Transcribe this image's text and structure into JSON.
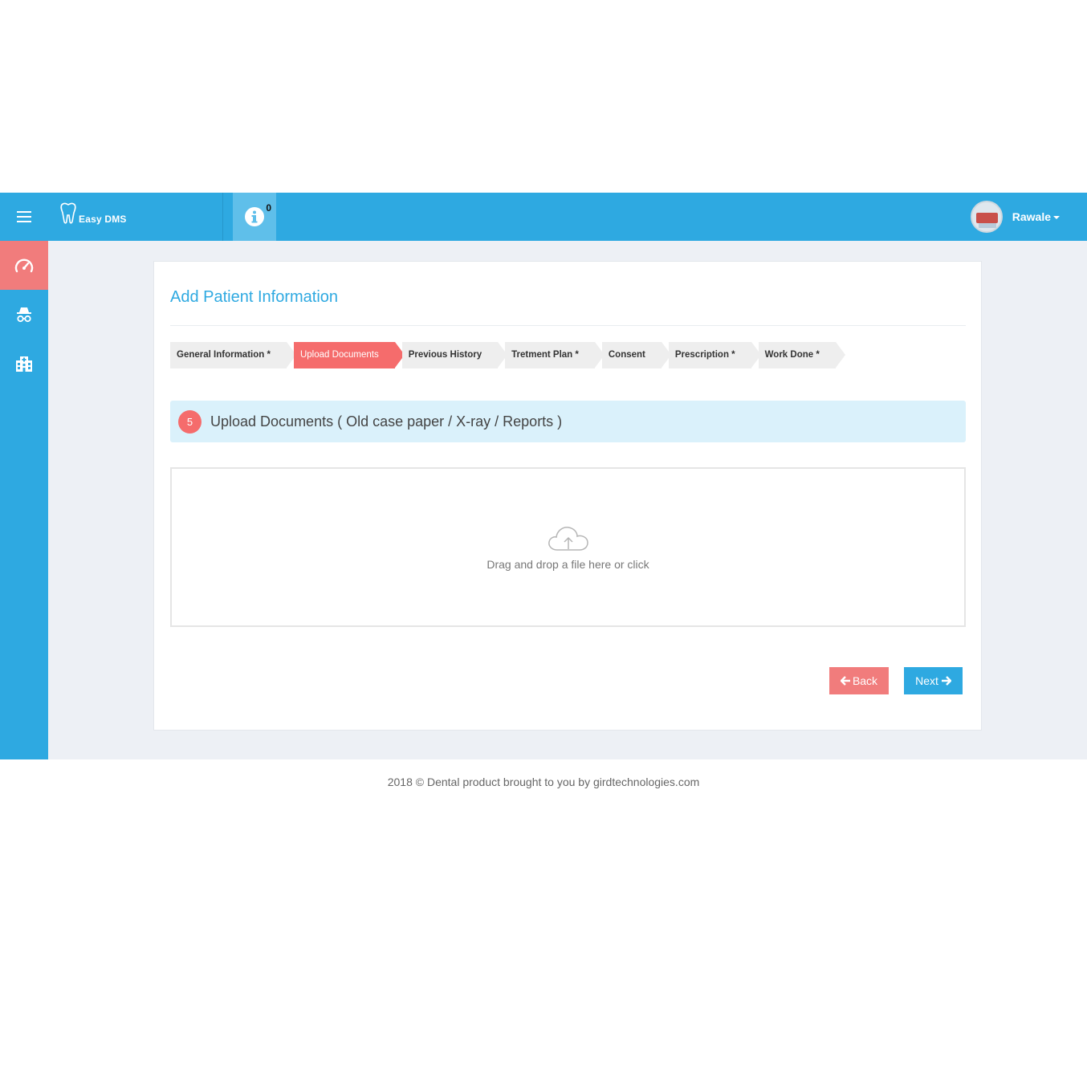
{
  "header": {
    "brand_text": "Easy DMS",
    "info_count": "0",
    "username": "Rawale"
  },
  "page": {
    "title": "Add Patient Information"
  },
  "steps": [
    {
      "label": "General Information *"
    },
    {
      "label": "Upload Documents"
    },
    {
      "label": "Previous History"
    },
    {
      "label": "Tretment Plan *"
    },
    {
      "label": "Consent"
    },
    {
      "label": "Prescription *"
    },
    {
      "label": "Work Done *"
    }
  ],
  "section": {
    "number": "5",
    "title": "Upload Documents ( Old case paper / X-ray / Reports )"
  },
  "dropzone": {
    "text": "Drag and drop a file here or click"
  },
  "buttons": {
    "back": "Back",
    "next": "Next"
  },
  "footer": {
    "text": "2018 © Dental product brought to you by girdtechnologies.com"
  },
  "colors": {
    "primary": "#2ea9e1",
    "accent": "#f56c6c",
    "section_bg": "#daf1fb",
    "page_bg": "#edf0f5"
  }
}
